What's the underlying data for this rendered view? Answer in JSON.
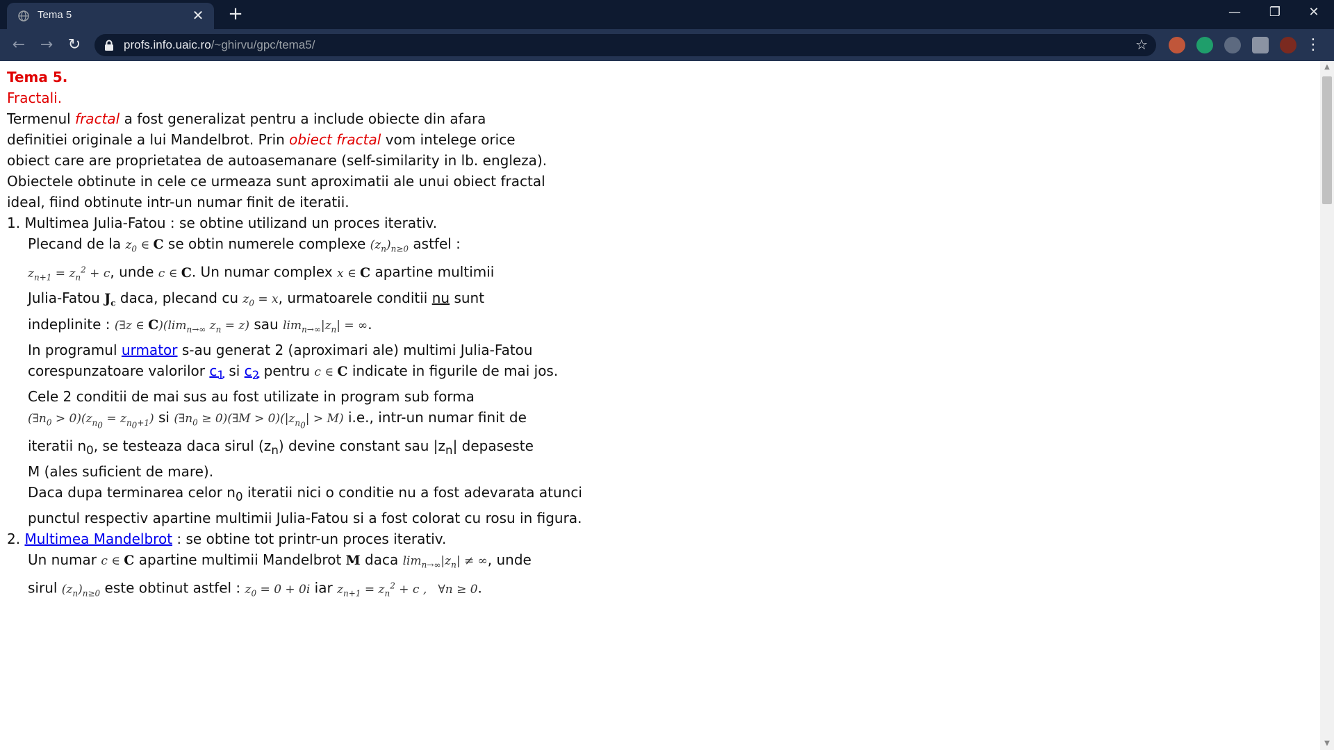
{
  "browser": {
    "tab_title": "Tema 5",
    "tab_close": "✕",
    "new_tab": "+",
    "window_controls": {
      "minimize": "—",
      "restore": "❐",
      "close": "✕"
    },
    "nav": {
      "back": "←",
      "forward": "→",
      "reload": "↻"
    },
    "url_host": "profs.info.uaic.ro",
    "url_path": "/~ghirvu/gpc/tema5/",
    "bookmark_star": "☆",
    "menu": "⋮",
    "extensions": [
      "extension-icon-1",
      "shield-check-icon",
      "extension-icon-3",
      "puzzle-icon",
      "profile-avatar"
    ],
    "colors": {
      "frame": "#0e1a30",
      "toolbar": "#243452",
      "accent_red": "#e00000",
      "link": "#0000ee"
    }
  },
  "page": {
    "title": "Tema 5.",
    "subtitle": "Fractali.",
    "intro": {
      "p1": "Termenul ",
      "term_fractal": "fractal",
      "p2": " a fost generalizat pentru a include obiecte din afara",
      "p3": "definitiei originale a lui Mandelbrot. Prin ",
      "term_obiect": "obiect fractal",
      "p4": " vom intelege orice",
      "p5": "obiect care are proprietatea de autoasemanare (self-similarity in lb. engleza).",
      "p6": "Obiectele obtinute in cele ce urmeaza sunt aproximatii ale unui obiect fractal",
      "p7": "ideal, fiind obtinute intr-un numar finit de iteratii."
    },
    "section1": {
      "heading": "1. Multimea Julia-Fatou : se obtine utilizand un proces iterativ.",
      "l1a": "Plecand de la ",
      "l1b": " se obtin numerele complexe ",
      "l1c": " astfel :",
      "l2a": ", unde ",
      "l2b": ". Un numar complex ",
      "l2c": " apartine multimii",
      "l3a": "Julia-Fatou ",
      "l3b": " daca, plecand cu ",
      "l3c": ", urmatoarele conditii ",
      "l3nu": "nu",
      "l3d": " sunt",
      "l4a": "indeplinite : ",
      "l4b": " sau ",
      "l4c": ".",
      "l5a": "In programul ",
      "l5link": "urmator",
      "l5b": " s-au generat 2 (aproximari ale) multimi Julia-Fatou",
      "l6a": "corespunzatoare valorilor ",
      "l6c1": "c",
      "l6c1sub": "1",
      "l6b": " si ",
      "l6c2": "c",
      "l6c2sub": "2",
      "l6c": " pentru ",
      "l6d": " indicate in figurile de mai jos.",
      "l7": "Cele 2 conditii de mai sus au fost utilizate in program sub forma",
      "l8a": " si ",
      "l8b": " i.e., intr-un numar finit de",
      "l9a": "iteratii n",
      "l9sub": "0",
      "l9b": ", se testeaza daca sirul (z",
      "l9subn": "n",
      "l9c": ") devine constant sau |z",
      "l9subn2": "n",
      "l9d": "| depaseste",
      "l10": "M (ales suficient de mare).",
      "l11a": "Daca dupa terminarea celor n",
      "l11sub": "0",
      "l11b": " iteratii nici o conditie nu a fost adevarata atunci",
      "l12": "punctul respectiv apartine multimii Julia-Fatou si a fost colorat cu rosu in figura."
    },
    "section2": {
      "num": "2. ",
      "link": "Multimea Mandelbrot",
      "rest": " : se obtine tot printr-un proces iterativ.",
      "l1a": "Un numar ",
      "l1b": " apartine multimii Mandelbrot ",
      "l1c": " daca ",
      "l1d": ", unde",
      "l2a": "sirul ",
      "l2b": " este obtinut astfel : ",
      "l2c": " iar ",
      "l2d": "."
    }
  }
}
